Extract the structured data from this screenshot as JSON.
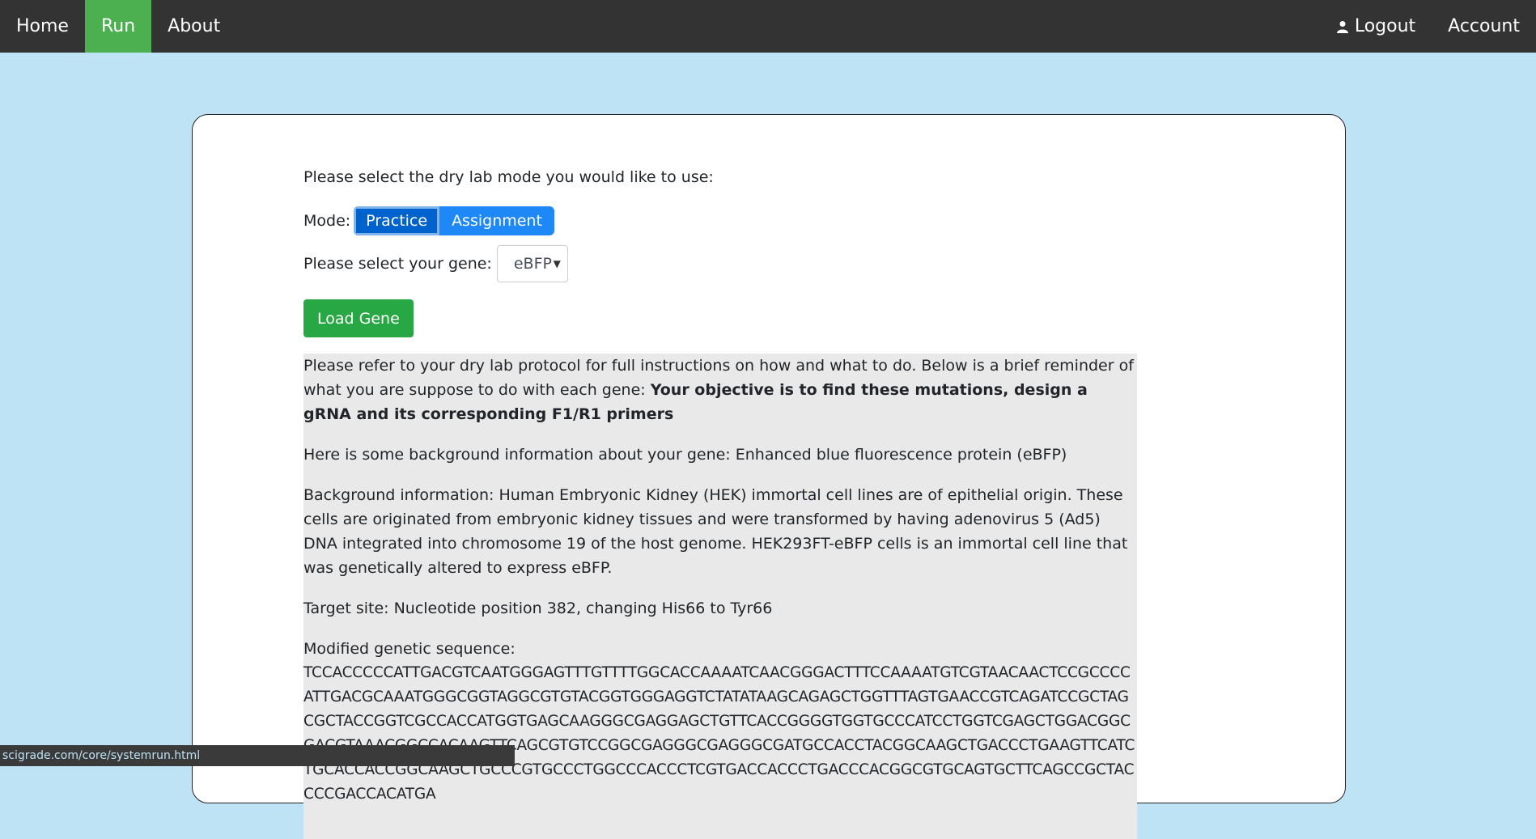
{
  "nav": {
    "home": "Home",
    "run": "Run",
    "about": "About",
    "logout": "Logout",
    "account": "Account"
  },
  "main": {
    "prompt": "Please select the dry lab mode you would like to use:",
    "mode_label": "Mode:",
    "mode_practice": "Practice",
    "mode_assignment": "Assignment",
    "gene_label": "Please select your gene:",
    "gene_selected": "eBFP",
    "load_button": "Load Gene"
  },
  "info": {
    "intro": "Please refer to your dry lab protocol for full instructions on how and what to do. Below is a brief reminder of what you are suppose to do with each gene: ",
    "objective": "Your objective is to find these mutations, design a gRNA and its corresponding F1/R1 primers",
    "background_intro": "Here is some background information about your gene: Enhanced blue fluorescence protein (eBFP)",
    "background": "Background information: Human Embryonic Kidney (HEK) immortal cell lines are of epithelial origin. These cells are originated from embryonic kidney tissues and were transformed by having adenovirus 5 (Ad5) DNA integrated into chromosome 19 of the host genome. HEK293FT-eBFP cells is an immortal cell line that was genetically altered to express eBFP.",
    "target": "Target site: Nucleotide position 382, changing His66 to Tyr66",
    "modified_label": "Modified genetic sequence:",
    "sequence": "TCCACCCCCATTGACGTCAATGGGAGTTTGTTTTGGCACCAAAATCAACGGGACTTTCCAAAATGTCGTAACAACTCCGCCCCATTGACGCAAATGGGCGGTAGGCGTGTACGGTGGGAGGTCTATATAAGCAGAGCTGGTTTAGTGAACCGTCAGATCCGCTAGCGCTACCGGTCGCCACCATGGTGAGCAAGGGCGAGGAGCTGTTCACCGGGGTGGTGCCCATCCTGGTCGAGCTGGACGGCGACGTAAACGGCCACAAGTTCAGCGTGTCCGGCGAGGGCGAGGGCGATGCCACCTACGGCAAGCTGACCCTGAAGTTCATCTGCACCACCGGCAAGCTGCCCGTGCCCTGGCCCACCCTCGTGACCACCCTGACCCACGGCGTGCAGTGCTTCAGCCGCTACCCCGACCACATGA"
  },
  "status_url": "scigrade.com/core/systemrun.html",
  "colors": {
    "navbar": "#333333",
    "active_tab": "#4caf50",
    "background": "#bde3f4",
    "primary_button": "#0062cc",
    "load_button": "#28a745",
    "info_box": "#e9e9e9"
  }
}
